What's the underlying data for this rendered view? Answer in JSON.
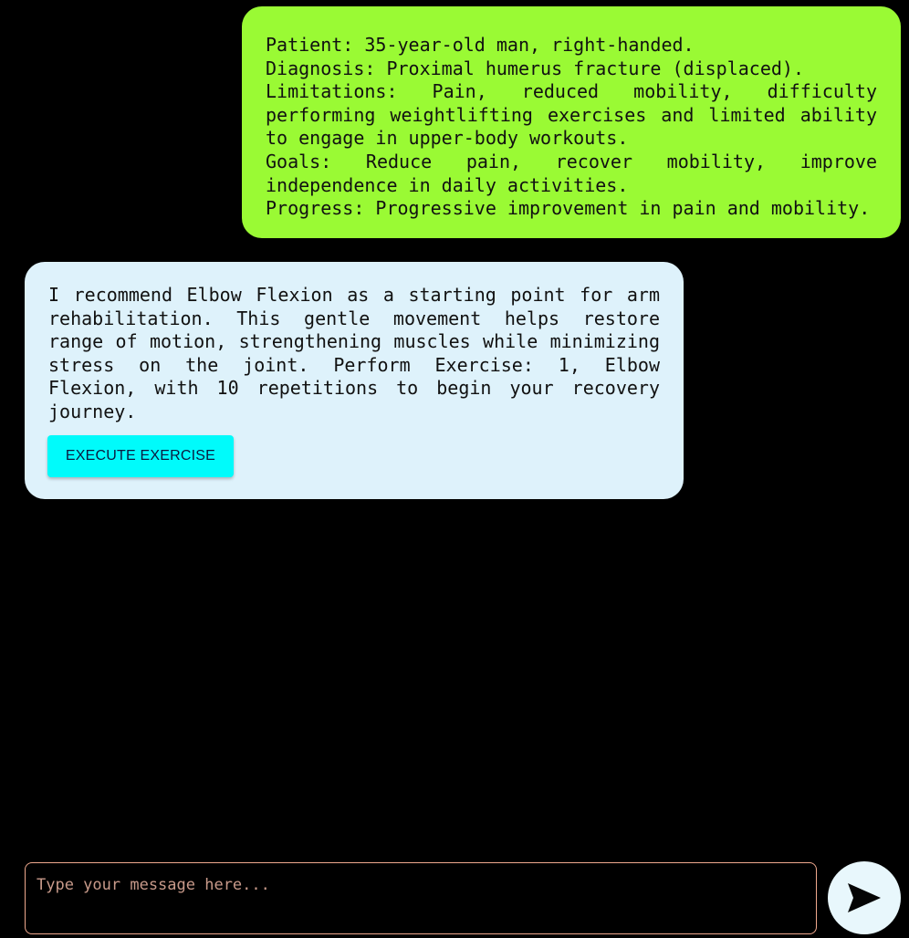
{
  "conversation": {
    "user_message": {
      "lines": [
        "Patient: 35-year-old man, right-handed.",
        "Diagnosis: Proximal humerus fracture (displaced).",
        "Limitations: Pain, reduced mobility, difficulty performing weightlifting exercises and limited ability to engage in upper-body workouts.",
        "Goals: Reduce pain, recover mobility, improve independence in daily activities.",
        "Progress: Progressive improvement in pain and mobility."
      ]
    },
    "assistant_message": {
      "text": "I recommend Elbow Flexion as a starting point for arm rehabilitation. This gentle movement helps restore range of motion, strengthening muscles while minimizing stress on the joint. Perform Exercise: 1, Elbow Flexion, with 10 repetitions to begin your recovery journey.",
      "button_label": "EXECUTE EXERCISE"
    }
  },
  "composer": {
    "placeholder": "Type your message here...",
    "value": "",
    "send_icon": "send-icon"
  },
  "colors": {
    "background": "#000000",
    "user_bubble": "#9afa34",
    "assistant_bubble": "#def2fb",
    "execute_button": "#00fbfb",
    "input_border": "#f0a98e",
    "send_button": "#e8f7fc"
  }
}
